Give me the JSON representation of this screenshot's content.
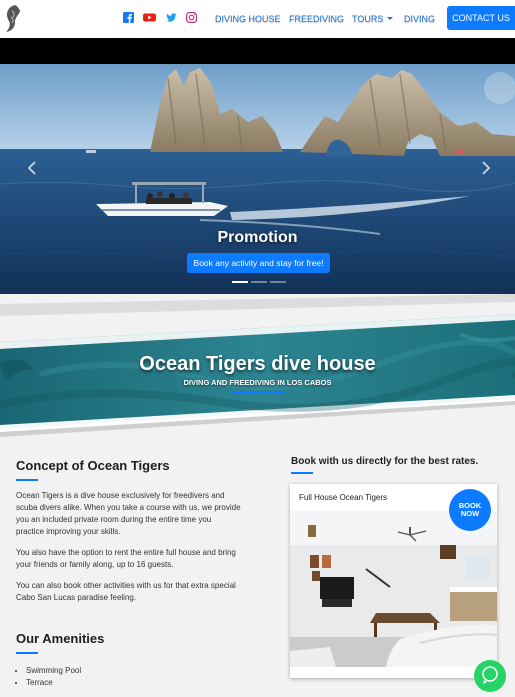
{
  "nav": {
    "social": [
      "facebook-icon",
      "youtube-icon",
      "twitter-icon",
      "instagram-icon"
    ],
    "links": [
      "DIVING HOUSE",
      "FREEDIVING",
      "TOURS",
      "DIVING"
    ],
    "contact": "CONTACT US"
  },
  "hero": {
    "title": "Promotion",
    "button": "Book any activity and stay for free!",
    "slides": 3,
    "active_slide": 1
  },
  "banner": {
    "title": "Ocean Tigers dive house",
    "subtitle": "DIVING AND FREEDIVING IN LOS CABOS"
  },
  "concept": {
    "title": "Concept of Ocean Tigers",
    "p1": "Ocean Tigers is a dive house exclusively for freedivers and scuba divers alike. When you take a course with us, we provide you an included private room during the entire time you practice improving your skills.",
    "p2": "You also have the option to rent the entire full house and bring your friends or family along, up to 16 guests.",
    "p3": "You can also book other activities with us for that extra special Cabo San Lucas paradise feeling."
  },
  "amenities": {
    "title": "Our Amenities",
    "items": [
      "Swimming Pool",
      "Terrace"
    ]
  },
  "booking": {
    "heading": "Book with us directly for the best rates.",
    "card_title": "Full House Ocean Tigers",
    "badge_line1": "BOOK",
    "badge_line2": "NOW"
  },
  "colors": {
    "accent": "#0d7bff",
    "nav_link": "#1a73d9",
    "banner_teal": "#1c6f7a",
    "whatsapp": "#25d366"
  }
}
